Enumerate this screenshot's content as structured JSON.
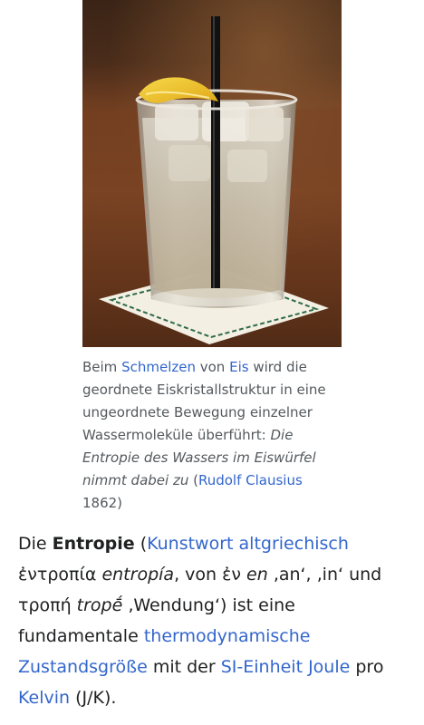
{
  "figure": {
    "image_alt": "Glas mit Eiswürfeln, Zitrone und Strohhalm",
    "caption": {
      "t1": "Beim ",
      "link_schmelzen": "Schmelzen",
      "t2": " von ",
      "link_eis": "Eis",
      "t3": " wird die geordnete Eiskristallstruktur in eine ungeordnete Bewegung einzelner Wassermoleküle überführt: ",
      "quote": "Die Entropie des Wassers im Eiswürfel nimmt dabei zu",
      "t4": " (",
      "link_clausius": "Rudolf Clausius",
      "t5": " 1862)"
    }
  },
  "article": {
    "t1": "Die ",
    "term": "Entropie",
    "t2": " (",
    "link_kunstwort": "Kunstwort",
    "t3": " ",
    "link_altgriechisch": "altgriechisch",
    "t4": " ἐντροπία ",
    "translit1": "entropía",
    "t5": ", von ἐν ",
    "translit2": "en",
    "t6": " ‚an‘, ‚in‘ und τροπή ",
    "translit3": "tropḗ",
    "t7": " ‚Wendung‘) ist eine fundamentale ",
    "link_thermo": "thermodynamische Zustandsgröße",
    "t8": " mit der ",
    "link_si": "SI-Einheit",
    "t9": " ",
    "link_joule": "Joule",
    "t10": " pro ",
    "link_kelvin": "Kelvin",
    "t11": " (J/K)."
  },
  "colors": {
    "link": "#3366cc",
    "caption_text": "#54595d",
    "body_text": "#202122"
  }
}
